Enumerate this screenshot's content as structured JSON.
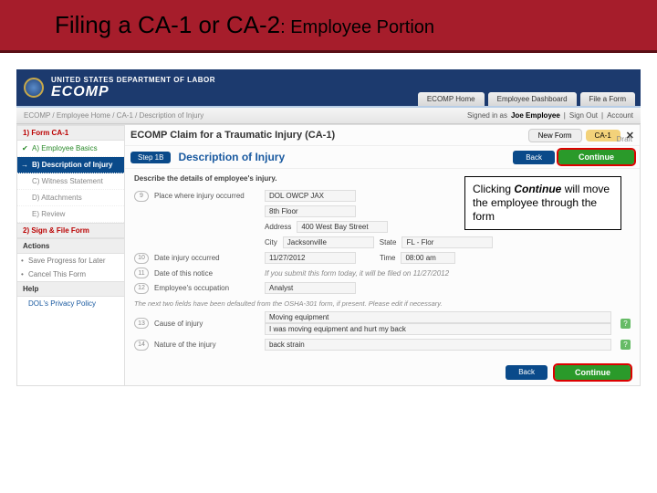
{
  "slide": {
    "title_main": "Filing a CA-1 or CA-2",
    "title_sub": ": Employee Portion"
  },
  "header": {
    "dept": "UNITED STATES DEPARTMENT OF LABOR",
    "logo": "ECOMP",
    "tabs": [
      "ECOMP Home",
      "Employee Dashboard",
      "File a Form"
    ]
  },
  "breadcrumb": {
    "path": "ECOMP / Employee Home / CA-1 / Description of Injury",
    "signed_label": "Signed in as",
    "signed_name": "Joe Employee",
    "links": [
      "Sign Out",
      "Account"
    ]
  },
  "sidebar": {
    "sec1": "1) Form CA-1",
    "items": [
      "A) Employee Basics",
      "B) Description of Injury",
      "C) Witness Statement",
      "D) Attachments",
      "E) Review"
    ],
    "sec2": "2) Sign & File Form",
    "actions_h": "Actions",
    "actions": [
      "Save Progress for Later",
      "Cancel This Form"
    ],
    "help_h": "Help",
    "help_link": "DOL's Privacy Policy"
  },
  "main": {
    "title": "ECOMP Claim for a Traumatic Injury (CA-1)",
    "pill_new": "New Form",
    "pill_form": "CA-1",
    "draft": "Draft",
    "step_badge": "Step 1B",
    "step_title": "Description of Injury",
    "back": "Back",
    "cont": "Continue",
    "desc": "Describe the details of employee's injury.",
    "note": "The next two fields have been defaulted from the OSHA-301 form, if present. Please edit if necessary.",
    "submit_note_prefix": "If you submit this form today, it will be filed on",
    "submit_date": "11/27/2012",
    "fields": {
      "f9_num": "9",
      "f9_label": "Place where injury occurred",
      "f9_val": "DOL OWCP JAX",
      "f9_floor": "8th Floor",
      "f9_addr_l": "Address",
      "f9_addr_v": "400 West Bay Street",
      "f9_city_l": "City",
      "f9_city_v": "Jacksonville",
      "f9_state_l": "State",
      "f9_state_v": "FL - Flor",
      "f10_num": "10",
      "f10_label": "Date injury occurred",
      "f10_val": "11/27/2012",
      "f10_time_l": "Time",
      "f10_time_v": "08:00 am",
      "f11_num": "11",
      "f11_label": "Date of this notice",
      "f12_num": "12",
      "f12_label": "Employee's occupation",
      "f12_val": "Analyst",
      "f13_num": "13",
      "f13_label": "Cause of injury",
      "f13_val1": "Moving equipment",
      "f13_val2": "I was moving equipment and hurt my back",
      "f14_num": "14",
      "f14_label": "Nature of the injury",
      "f14_val": "back strain"
    }
  },
  "callout": {
    "pre": "Clicking ",
    "bold": "Continue",
    "post": " will move the employee through the form"
  }
}
